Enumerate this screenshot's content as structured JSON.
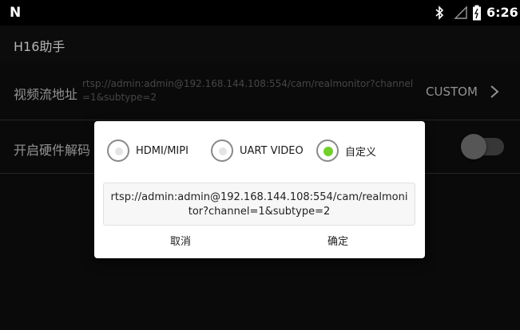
{
  "status_bar": {
    "time": "6:26",
    "left_icon": "N",
    "icons": [
      "bluetooth-icon",
      "signal-icon",
      "battery-icon"
    ]
  },
  "app": {
    "title": "H16助手"
  },
  "preferences": {
    "stream": {
      "label": "视频流地址",
      "summary": "rtsp://admin:admin@192.168.144.108:554/cam/realmonitor?channel=1&subtype=2",
      "value": "CUSTOM"
    },
    "hw_decode": {
      "label": "开启硬件解码",
      "enabled": false
    }
  },
  "dialog": {
    "options": [
      {
        "label": "HDMI/MIPI",
        "checked": false
      },
      {
        "label": "UART VIDEO",
        "checked": false
      },
      {
        "label": "自定义",
        "checked": true
      }
    ],
    "url_value": "rtsp://admin:admin@192.168.144.108:554/cam/realmonitor?channel=1&subtype=2",
    "cancel_label": "取消",
    "ok_label": "确定"
  },
  "colors": {
    "radio_checked": "#73cf2c",
    "background": "#0b0b0b"
  }
}
